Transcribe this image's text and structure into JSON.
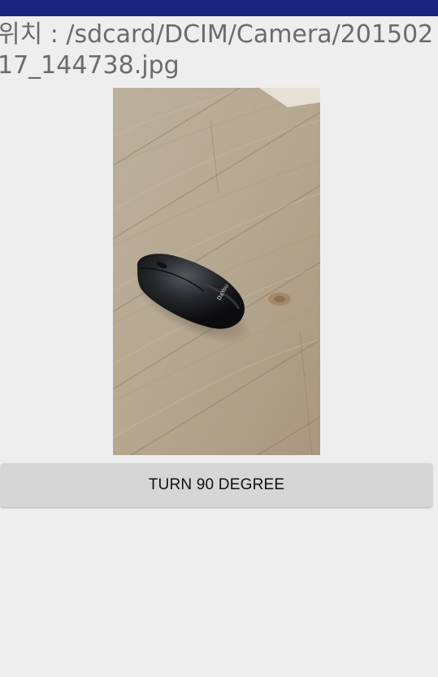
{
  "status_bar": {
    "color": "#1a237e"
  },
  "location": {
    "path_text": "위치 : /sdcard/DCIM/Camera/20150217_144738.jpg"
  },
  "image": {
    "description_icon": "photo-of-computer-mouse-on-wood-floor",
    "mouse_logo_text": "DaYou"
  },
  "actions": {
    "turn_label": "TURN 90 DEGREE"
  }
}
